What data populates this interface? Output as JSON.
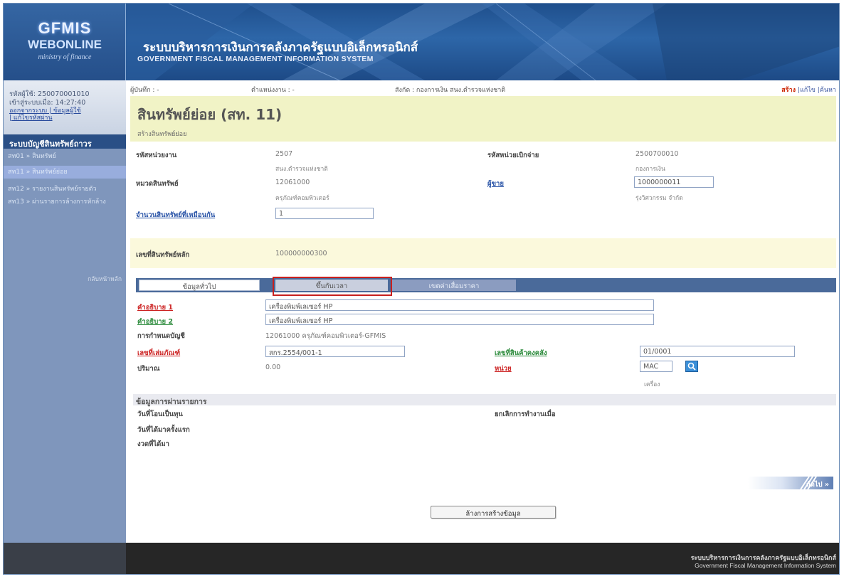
{
  "header": {
    "logo_line1": "GFMIS",
    "logo_line2": "WEBONLINE",
    "logo_line3": "ministry of finance",
    "title_th": "ระบบบริหารการเงินการคลังภาครัฐแบบอิเล็กทรอนิกส์",
    "title_en": "GOVERNMENT FISCAL MANAGEMENT INFORMATION SYSTEM"
  },
  "sidebar": {
    "user_id": "รหัสผู้ใช้: 250070001010",
    "login_time": "เข้าสู่ระบบเมื่อ: 14:27:40",
    "logout_link": "ออกจากระบบ | ข้อมูลผู้ใช้",
    "change_password_link": "| แก้ไขรหัสผ่าน",
    "menu_title": "ระบบบัญชีสินทรัพย์ถาวร",
    "items": [
      {
        "label": "สท01 » สินทรัพย์"
      },
      {
        "label": "สท11 » สินทรัพย์ย่อย"
      },
      {
        "label": "สท12 » รายงานสินทรัพย์รายตัว"
      },
      {
        "label": "สท13 » ผ่านรายการล้างการหักล้าง"
      }
    ],
    "back_link": "กลับหน้าหลัก"
  },
  "topbar": {
    "recorder": "ผู้บันทึก : -",
    "unit": "ตำแหน่งงาน : -",
    "affiliation": "สังกัด : กองการเงิน สนง.ตำรวจแห่งชาติ",
    "create": "สร้าง",
    "edit": "|แก้ไข",
    "search": "|ค้นหา"
  },
  "page": {
    "title": "สินทรัพย์ย่อย (สท. 11)",
    "subtitle": "สร้างสินทรัพย์ย่อย"
  },
  "form": {
    "agency_code_label": "รหัสหน่วยงาน",
    "agency_code": "2507",
    "agency_name": "สนง.ตำรวจแห่งชาติ",
    "disbursing_unit_label": "รหัสหน่วยเบิกจ่าย",
    "disbursing_unit": "2500700010",
    "disbursing_unit_name": "กองการเงิน",
    "asset_class_label": "หมวดสินทรัพย์",
    "asset_class": "12061000",
    "asset_class_name": "ครุภัณฑ์คอมพิวเตอร์",
    "vendor_label": "ผู้ขาย",
    "vendor_code": "1000000011",
    "vendor_name": "รุ่งวิศวกรรม จำกัด",
    "asset_count_label": "จำนวนสินทรัพย์ที่เหมือนกัน",
    "asset_count": "1",
    "main_asset_no_label": "เลขที่สินทรัพย์หลัก",
    "main_asset_no": "100000000300"
  },
  "tabs": {
    "general": "ข้อมูลทั่วไป",
    "registration": "ขึ้นกับเวลา",
    "depreciation": "เขตค่าเสื่อมราคา"
  },
  "detail": {
    "desc1_label": "คำอธิบาย 1",
    "desc1": "เครื่องพิมพ์เลเซอร์ HP",
    "desc2_label": "คำอธิบาย 2",
    "desc2": "เครื่องพิมพ์เลเซอร์ HP",
    "gl_label": "การกำหนดบัญชี",
    "gl_value": "12061000 ครุภัณฑ์คอมพิวเตอร์-GFMIS",
    "inventory_label": "เลขที่เล่มภัณฑ์",
    "inventory_value": "สกร.2554/001-1",
    "stock_no_label": "เลขที่สินค้าคงคลัง",
    "stock_no_value": "01/0001",
    "quantity_label": "ปริมาณ",
    "quantity_value": "0.00",
    "unit_label": "หน่วย",
    "unit_value": "MAC",
    "unit_name": "เครื่อง"
  },
  "posting": {
    "section_title": "ข้อมูลการผ่านรายการ",
    "capitalization_date_label": "วันที่โอนเป็นทุน",
    "first_acquisition_label": "วันที่ได้มาครั้งแรก",
    "acquisition_period_label": "งวดที่ได้มา",
    "deactivation_label": "ยกเลิกการทำงานเมื่อ"
  },
  "actions": {
    "next": "ถัดไป »",
    "cancel": "ล้างการสร้างข้อมูล"
  },
  "footer": {
    "th": "ระบบบริหารการเงินการคลังภาครัฐแบบอิเล็กทรอนิกส์",
    "en": "Government Fiscal Management Information System"
  },
  "colors": {
    "header_blue": "#2d66a8",
    "sidebar_blue": "#7f96bc",
    "title_bg": "#f1f3c6",
    "highlight_red": "#c8201e",
    "tab_dark": "#4a6a9a"
  }
}
